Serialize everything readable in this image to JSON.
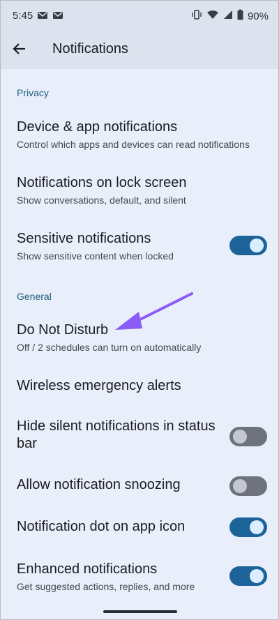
{
  "status_bar": {
    "time": "5:45",
    "battery_percent": "90%",
    "icons": [
      "gmail-icon",
      "gmail-icon",
      "vibrate-icon",
      "wifi-icon",
      "signal-icon",
      "battery-icon"
    ]
  },
  "app_bar": {
    "title": "Notifications",
    "back_icon": "arrow-back-icon"
  },
  "sections": [
    {
      "header": "Privacy",
      "items": [
        {
          "title": "Device & app notifications",
          "subtitle": "Control which apps and devices can read notifications"
        },
        {
          "title": "Notifications on lock screen",
          "subtitle": "Show conversations, default, and silent"
        },
        {
          "title": "Sensitive notifications",
          "subtitle": "Show sensitive content when locked",
          "toggle": true
        }
      ]
    },
    {
      "header": "General",
      "items": [
        {
          "title": "Do Not Disturb",
          "subtitle": "Off / 2 schedules can turn on automatically"
        },
        {
          "title": "Wireless emergency alerts"
        },
        {
          "title_line1": "Hide silent notifications in status",
          "title_line2": "bar",
          "toggle": false
        },
        {
          "title": "Allow notification snoozing",
          "toggle": false
        },
        {
          "title": "Notification dot on app icon",
          "toggle": true
        },
        {
          "title": "Enhanced notifications",
          "subtitle": "Get suggested actions, replies, and more",
          "toggle": true
        }
      ]
    }
  ],
  "colors": {
    "background": "#e9effa",
    "header_bar": "#dde3ee",
    "section_header": "#1c5d7d",
    "toggle_on": "#1c639a",
    "toggle_off": "#6e727b",
    "annotation_arrow": "#8b5cf6"
  }
}
